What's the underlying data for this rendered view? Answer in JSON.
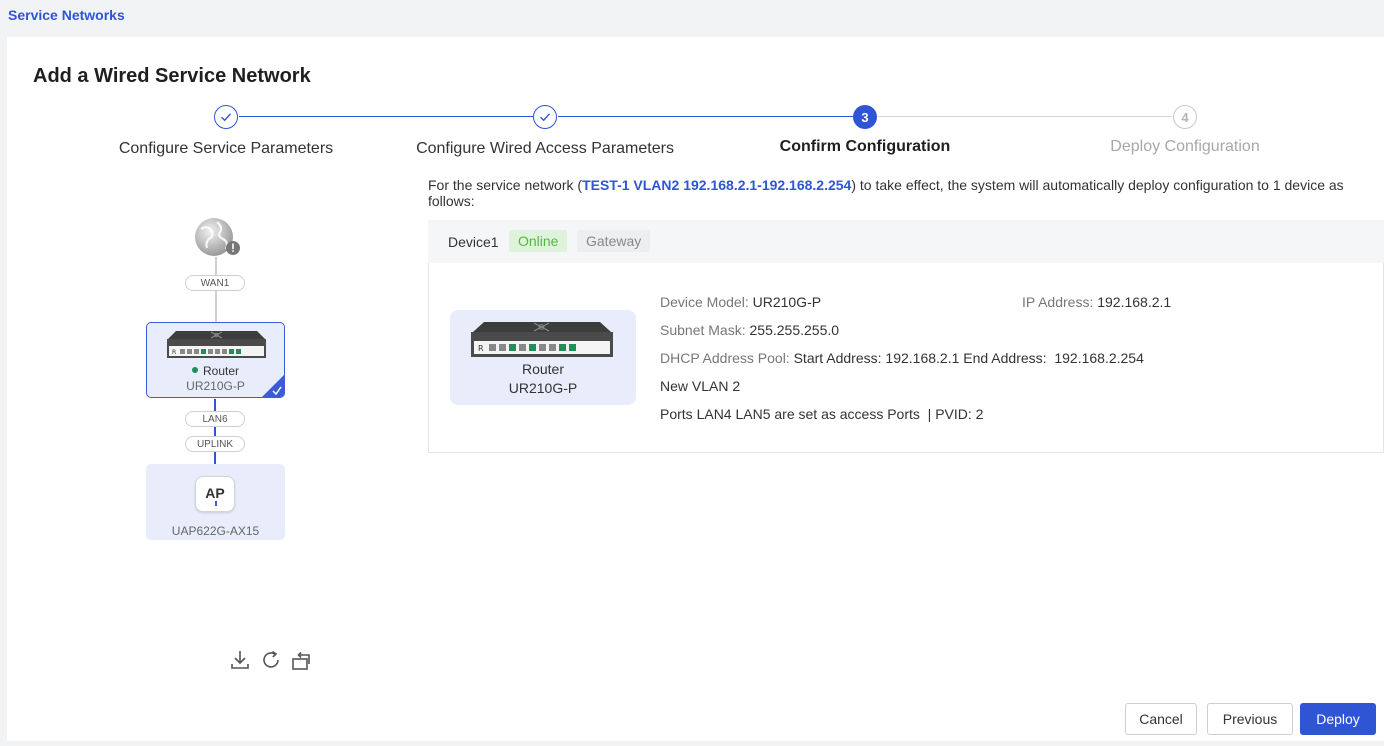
{
  "breadcrumb": {
    "label": "Service Networks"
  },
  "page": {
    "title": "Add a Wired Service Network"
  },
  "steps": [
    {
      "number": "1",
      "label": "Configure Service Parameters",
      "state": "done"
    },
    {
      "number": "2",
      "label": "Configure Wired Access Parameters",
      "state": "done"
    },
    {
      "number": "3",
      "label": "Confirm Configuration",
      "state": "active"
    },
    {
      "number": "4",
      "label": "Deploy Configuration",
      "state": "todo"
    }
  ],
  "topology": {
    "wan_label": "WAN1",
    "router": {
      "name": "Router",
      "model": "UR210G-P",
      "status_color": "#1f8f57"
    },
    "lan_label": "LAN6",
    "uplink_label": "UPLINK",
    "ap": {
      "badge": "AP",
      "model": "UAP622G-AX15"
    },
    "tools": [
      "download-icon",
      "refresh-icon",
      "switch-view-icon"
    ]
  },
  "info": {
    "prefix": "For the service network (",
    "highlight": "TEST-1 VLAN2 192.168.2.1-192.168.2.254",
    "suffix": ") to take effect, the system will automatically deploy configuration to 1 device as follows:"
  },
  "device": {
    "tab_label": "Device1",
    "status_badge": "Online",
    "role_badge": "Gateway",
    "tile_name": "Router",
    "tile_model": "UR210G-P",
    "model_label": "Device Model:",
    "model_value": "UR210G-P",
    "ip_label": "IP Address:",
    "ip_value": "192.168.2.1",
    "subnet_label": "Subnet Mask:",
    "subnet_value": "255.255.255.0",
    "dhcp_label": "DHCP Address Pool:",
    "dhcp_start_label": "Start Address:",
    "dhcp_start_value": "192.168.2.1",
    "dhcp_end_label": "End Address:",
    "dhcp_end_value": "192.168.2.254",
    "vlan_text": "New VLAN 2",
    "ports_text": "Ports LAN4 LAN5 are set as access Ports",
    "pvid_text": "| PVID: 2"
  },
  "buttons": {
    "cancel": "Cancel",
    "previous": "Previous",
    "deploy": "Deploy"
  },
  "colors": {
    "primary": "#2f55d4",
    "online_bg": "#dff3dc",
    "online_text": "#52b83f"
  }
}
